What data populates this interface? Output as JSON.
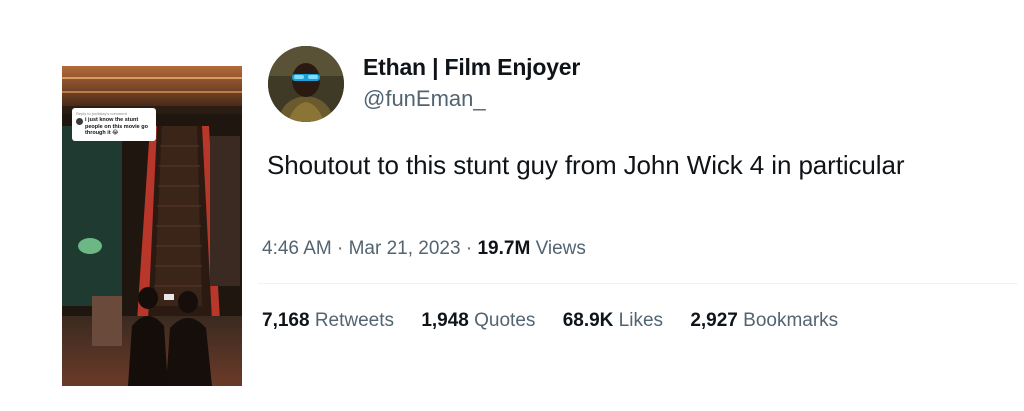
{
  "author": {
    "display_name": "Ethan | Film Enjoyer",
    "handle": "@funEman_"
  },
  "tweet": {
    "text": "Shoutout to this stunt guy from John Wick 4 in particular"
  },
  "meta": {
    "time": "4:46 AM",
    "separator": "·",
    "date": "Mar 21, 2023",
    "views_count": "19.7M",
    "views_label": "Views"
  },
  "stats": [
    {
      "count": "7,168",
      "label": "Retweets"
    },
    {
      "count": "1,948",
      "label": "Quotes"
    },
    {
      "count": "68.9K",
      "label": "Likes"
    },
    {
      "count": "2,927",
      "label": "Bookmarks"
    }
  ],
  "media": {
    "comment_reply": "Reply to jordislay's comment",
    "comment_text": "i just know the stunt people on this movie go through it 😂"
  }
}
